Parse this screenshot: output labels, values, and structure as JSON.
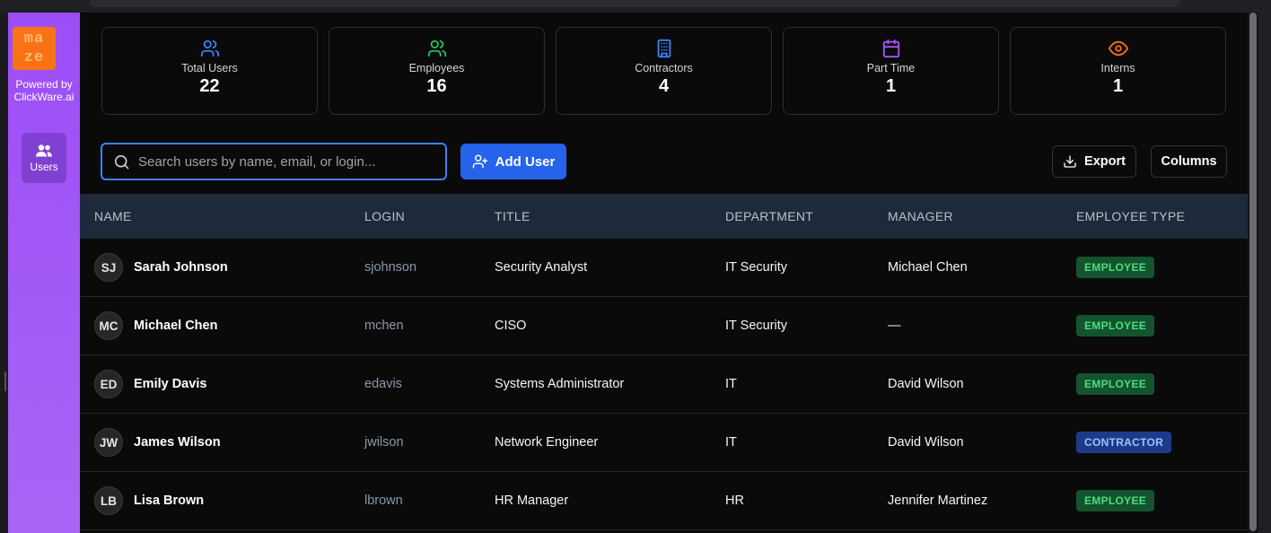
{
  "brand": {
    "logo_line1": "ma",
    "logo_line2": "ze",
    "powered_line1": "Powered by",
    "powered_line2": "ClickWare.ai",
    "accent": "#9d4df7",
    "logo_color": "#f97316"
  },
  "sidebar": {
    "items": [
      {
        "label": "Users",
        "icon": "users-icon",
        "active": true
      }
    ]
  },
  "stats": [
    {
      "label": "Total Users",
      "value": "22",
      "icon": "users-icon",
      "color": "#3b82f6"
    },
    {
      "label": "Employees",
      "value": "16",
      "icon": "users-icon",
      "color": "#22c55e"
    },
    {
      "label": "Contractors",
      "value": "4",
      "icon": "building-icon",
      "color": "#3b82f6"
    },
    {
      "label": "Part Time",
      "value": "1",
      "icon": "calendar-icon",
      "color": "#a855f7"
    },
    {
      "label": "Interns",
      "value": "1",
      "icon": "eye-icon",
      "color": "#f97316"
    }
  ],
  "toolbar": {
    "search_placeholder": "Search users by name, email, or login...",
    "search_value": "",
    "add_label": "Add User",
    "export_label": "Export",
    "columns_label": "Columns"
  },
  "table": {
    "headers": [
      "NAME",
      "LOGIN",
      "TITLE",
      "DEPARTMENT",
      "MANAGER",
      "EMPLOYEE TYPE"
    ],
    "rows": [
      {
        "initials": "SJ",
        "name": "Sarah Johnson",
        "login": "sjohnson",
        "title": "Security Analyst",
        "department": "IT Security",
        "manager": "Michael Chen",
        "type": "EMPLOYEE",
        "type_kind": "employee"
      },
      {
        "initials": "MC",
        "name": "Michael Chen",
        "login": "mchen",
        "title": "CISO",
        "department": "IT Security",
        "manager": "—",
        "type": "EMPLOYEE",
        "type_kind": "employee"
      },
      {
        "initials": "ED",
        "name": "Emily Davis",
        "login": "edavis",
        "title": "Systems Administrator",
        "department": "IT",
        "manager": "David Wilson",
        "type": "EMPLOYEE",
        "type_kind": "employee"
      },
      {
        "initials": "JW",
        "name": "James Wilson",
        "login": "jwilson",
        "title": "Network Engineer",
        "department": "IT",
        "manager": "David Wilson",
        "type": "CONTRACTOR",
        "type_kind": "contractor"
      },
      {
        "initials": "LB",
        "name": "Lisa Brown",
        "login": "lbrown",
        "title": "HR Manager",
        "department": "HR",
        "manager": "Jennifer Martinez",
        "type": "EMPLOYEE",
        "type_kind": "employee"
      }
    ]
  }
}
